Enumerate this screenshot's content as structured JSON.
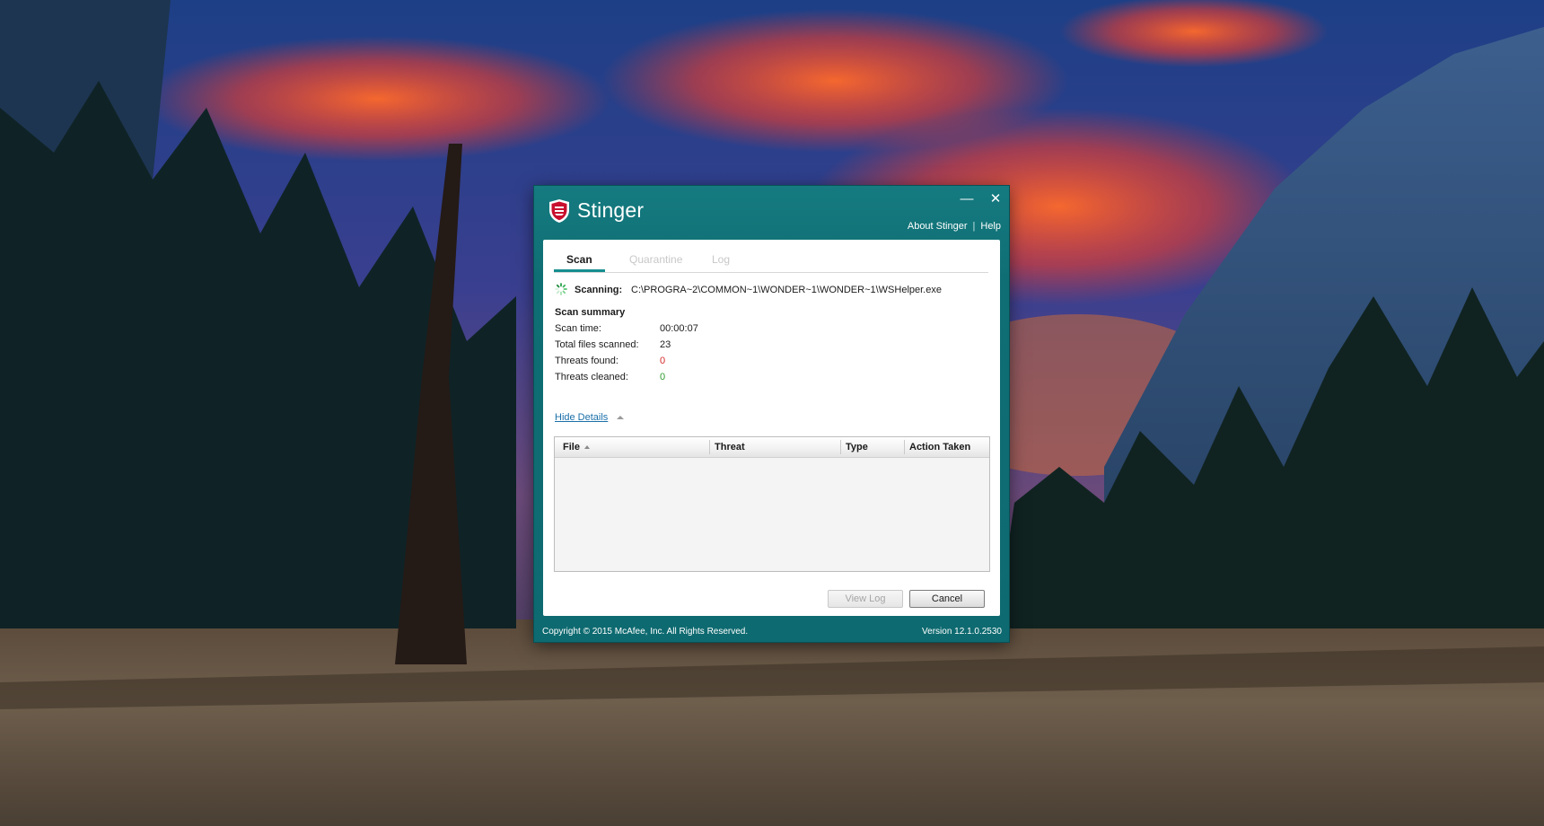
{
  "window": {
    "title": "Stinger",
    "minimize_glyph": "—",
    "close_glyph": "✕"
  },
  "top_links": {
    "about": "About Stinger",
    "separator": "|",
    "help": "Help"
  },
  "tabs": [
    {
      "label": "Scan",
      "active": true
    },
    {
      "label": "Quarantine",
      "active": false
    },
    {
      "label": "Log",
      "active": false
    }
  ],
  "scanning": {
    "label": "Scanning:",
    "path": "C:\\PROGRA~2\\COMMON~1\\WONDER~1\\WONDER~1\\WSHelper.exe"
  },
  "summary": {
    "title": "Scan summary",
    "rows": [
      {
        "label": "Scan time:",
        "value": "00:00:07"
      },
      {
        "label": "Total files scanned:",
        "value": "23"
      },
      {
        "label": "Threats found:",
        "value": "0"
      },
      {
        "label": "Threats cleaned:",
        "value": "0"
      }
    ]
  },
  "details_toggle": "Hide Details",
  "table": {
    "columns": [
      "File",
      "Threat",
      "Type",
      "Action Taken"
    ],
    "rows": []
  },
  "buttons": {
    "view_log": "View Log",
    "cancel": "Cancel"
  },
  "footer": {
    "copyright": "Copyright © 2015 McAfee, Inc. All Rights Reserved.",
    "version": "Version 12.1.0.2530"
  },
  "colors": {
    "window_teal": "#0f6e74",
    "tab_accent": "#168e8f",
    "threats_found": "#d42b2b",
    "threats_cleaned": "#2f9a2f",
    "link": "#1a6fa8"
  },
  "icons": {
    "logo": "mcafee-shield-icon",
    "spinner": "loading-spinner-icon",
    "sort": "sort-ascending-icon",
    "toggle": "caret-up-icon"
  }
}
